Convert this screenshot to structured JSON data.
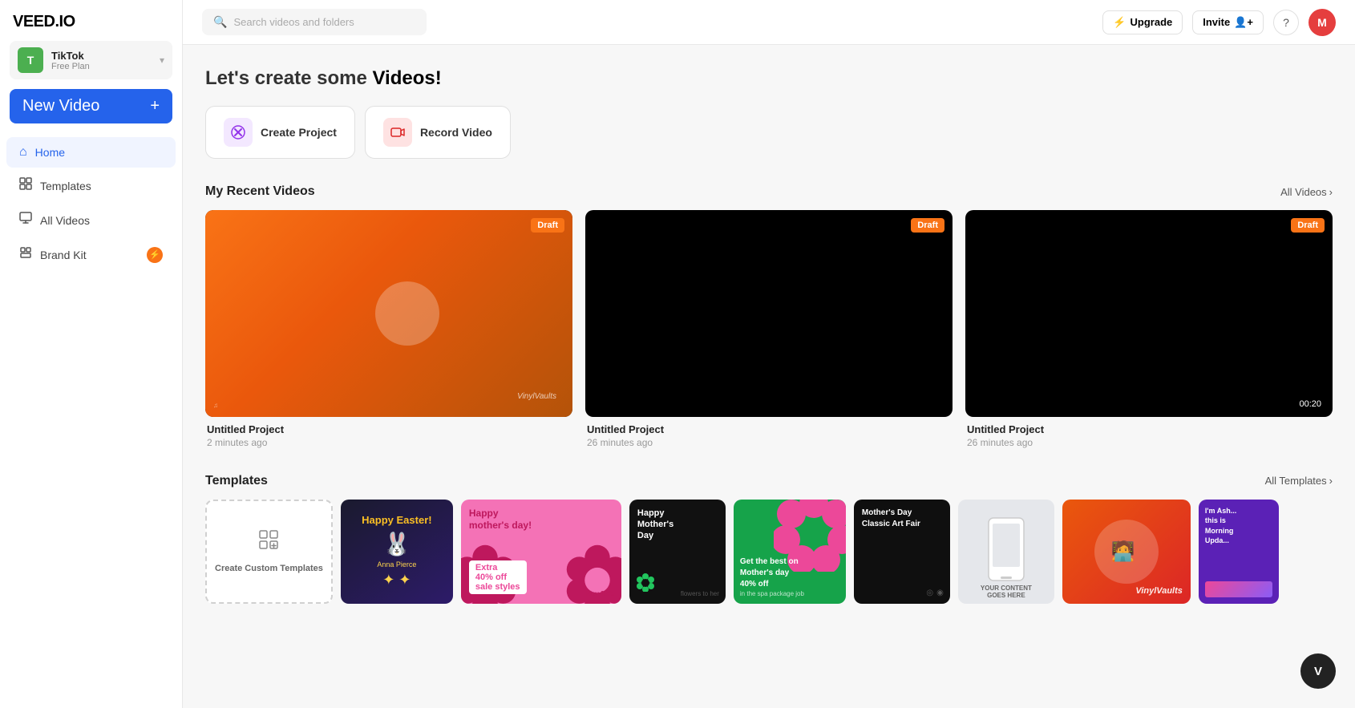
{
  "logo": {
    "text": "VEED.IO"
  },
  "workspace": {
    "initial": "T",
    "name": "TikTok",
    "plan": "Free Plan",
    "chevron": "▾"
  },
  "sidebar": {
    "new_video_label": "New Video",
    "new_video_plus": "+",
    "items": [
      {
        "id": "home",
        "label": "Home",
        "icon": "⌂",
        "active": true
      },
      {
        "id": "templates",
        "label": "Templates",
        "icon": "⊞"
      },
      {
        "id": "all-videos",
        "label": "All Videos",
        "icon": "🗂"
      },
      {
        "id": "brand-kit",
        "label": "Brand Kit",
        "icon": "⬡",
        "badge": "!"
      }
    ]
  },
  "header": {
    "search_placeholder": "Search videos and folders",
    "upgrade_label": "Upgrade",
    "invite_label": "Invite",
    "help_label": "?",
    "user_initial": "M"
  },
  "hero": {
    "title_prefix": "Let's create some ",
    "title_bold": "Videos!"
  },
  "actions": [
    {
      "id": "create-project",
      "label": "Create Project",
      "icon": "✂",
      "icon_class": "create-icon-bg"
    },
    {
      "id": "record-video",
      "label": "Record Video",
      "icon": "⏺",
      "icon_class": "record-icon-bg"
    }
  ],
  "recent_videos": {
    "section_title": "My Recent Videos",
    "all_link": "All Videos",
    "videos": [
      {
        "id": "v1",
        "name": "Untitled Project",
        "time": "2 minutes ago",
        "draft": true,
        "duration": null,
        "type": "orange"
      },
      {
        "id": "v2",
        "name": "Untitled Project",
        "time": "26 minutes ago",
        "draft": true,
        "duration": null,
        "type": "black"
      },
      {
        "id": "v3",
        "name": "Untitled Project",
        "time": "26 minutes ago",
        "draft": true,
        "duration": "00:20",
        "type": "black"
      }
    ]
  },
  "templates": {
    "section_title": "Templates",
    "all_link": "All Templates",
    "create_label": "Create Custom Templates",
    "items": [
      {
        "id": "t0",
        "label": "Create Custom Templates",
        "type": "create"
      },
      {
        "id": "t1",
        "label": "Happy Easter",
        "type": "easter"
      },
      {
        "id": "t2",
        "label": "Happy mother's day! Extra 40% off sale styles",
        "type": "mothers-pink"
      },
      {
        "id": "t3",
        "label": "Happy Mother's Day",
        "type": "mothers-dark"
      },
      {
        "id": "t4",
        "label": "Get the best on Mother's day 40% off",
        "type": "mothers-green"
      },
      {
        "id": "t5",
        "label": "Mother's Day Classic Art Fair",
        "type": "mothers-dark2"
      },
      {
        "id": "t6",
        "label": "Your content goes here - phone mockup",
        "type": "phone"
      },
      {
        "id": "t7",
        "label": "VinylVaults",
        "type": "vinyl"
      },
      {
        "id": "t8",
        "label": "Morning Update",
        "type": "morning"
      }
    ]
  },
  "floating": {
    "label": "V"
  }
}
